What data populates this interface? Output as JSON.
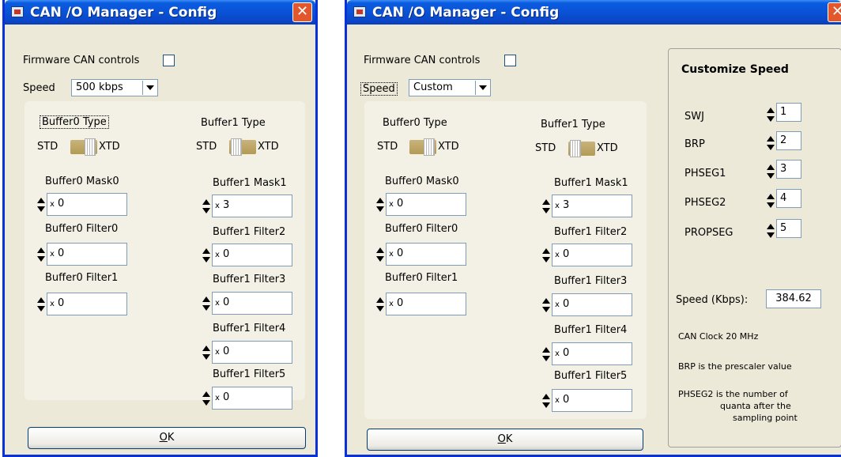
{
  "window_title": "CAN /O Manager - Config",
  "close_glyph": "✕",
  "left": {
    "firmware_label": "Firmware CAN controls",
    "speed_label": "Speed",
    "speed_value": "500 kbps",
    "buffer0_type": "Buffer0 Type",
    "buffer1_type": "Buffer1 Type",
    "std": "STD",
    "xtd": "XTD",
    "b0_fields": [
      {
        "label": "Buffer0 Mask0",
        "value": "0"
      },
      {
        "label": "Buffer0 Filter0",
        "value": "0"
      },
      {
        "label": "Buffer0 Filter1",
        "value": "0"
      }
    ],
    "b1_fields": [
      {
        "label": "Buffer1 Mask1",
        "value": "3"
      },
      {
        "label": "Buffer1 Filter2",
        "value": "0"
      },
      {
        "label": "Buffer1 Filter3",
        "value": "0"
      },
      {
        "label": "Buffer1 Filter4",
        "value": "0"
      },
      {
        "label": "Buffer1 Filter5",
        "value": "0"
      }
    ],
    "hex_prefix": "x",
    "ok_letter": "O",
    "ok_rest": "K"
  },
  "right": {
    "firmware_label": "Firmware CAN controls",
    "speed_label": "Speed",
    "speed_value": "Custom",
    "buffer0_type": "Buffer0 Type",
    "buffer1_type": "Buffer1 Type",
    "std": "STD",
    "xtd": "XTD",
    "b0_fields": [
      {
        "label": "Buffer0 Mask0",
        "value": "0"
      },
      {
        "label": "Buffer0 Filter0",
        "value": "0"
      },
      {
        "label": "Buffer0 Filter1",
        "value": "0"
      }
    ],
    "b1_fields": [
      {
        "label": "Buffer1 Mask1",
        "value": "3"
      },
      {
        "label": "Buffer1 Filter2",
        "value": "0"
      },
      {
        "label": "Buffer1 Filter3",
        "value": "0"
      },
      {
        "label": "Buffer1 Filter4",
        "value": "0"
      },
      {
        "label": "Buffer1 Filter5",
        "value": "0"
      }
    ],
    "hex_prefix": "x",
    "ok_letter": "O",
    "ok_rest": "K",
    "customize": {
      "title": "Customize Speed",
      "params": [
        {
          "label": "SWJ",
          "value": "1"
        },
        {
          "label": "BRP",
          "value": "2"
        },
        {
          "label": "PHSEG1",
          "value": "3"
        },
        {
          "label": "PHSEG2",
          "value": "4"
        },
        {
          "label": "PROPSEG",
          "value": "5"
        }
      ],
      "speed_kbps_label": "Speed (Kbps):",
      "speed_kbps_value": "384.62",
      "clock_note": "CAN Clock 20 MHz",
      "brp_note": "BRP is the prescaler value",
      "phseg2_note_line1": "PHSEG2 is the number of",
      "phseg2_note_line2": "quanta after the",
      "phseg2_note_line3": "sampling point"
    }
  }
}
